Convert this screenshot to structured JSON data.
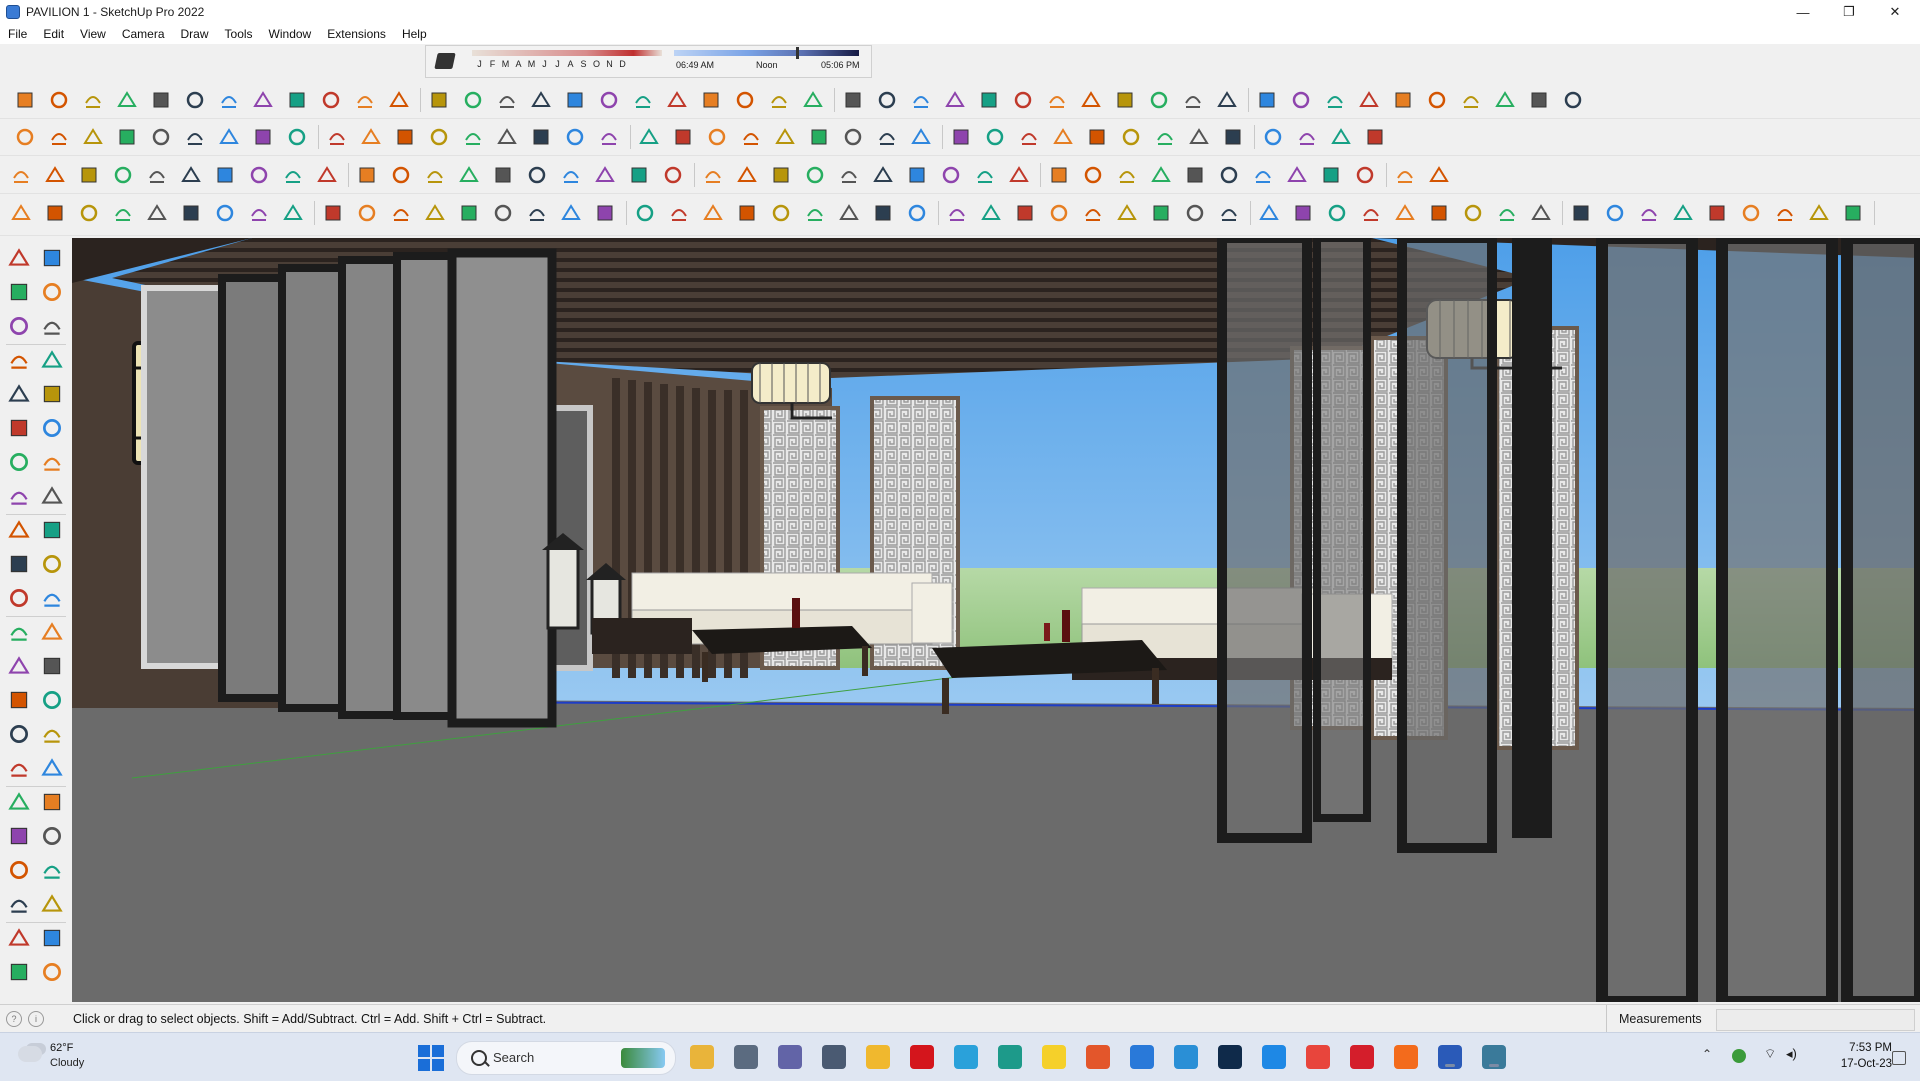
{
  "window": {
    "title": "PAVILION 1 - SketchUp Pro 2022",
    "minimize": "—",
    "maximize": "❐",
    "close": "✕"
  },
  "menu": [
    "File",
    "Edit",
    "View",
    "Camera",
    "Draw",
    "Tools",
    "Window",
    "Extensions",
    "Help"
  ],
  "shadow_settings": {
    "months": [
      "J",
      "F",
      "M",
      "A",
      "M",
      "J",
      "J",
      "A",
      "S",
      "O",
      "N",
      "D"
    ],
    "time_start": "06:49 AM",
    "time_noon": "Noon",
    "time_end": "05:06 PM"
  },
  "status": {
    "hint": "Click or drag to select objects. Shift = Add/Subtract. Ctrl = Add. Shift + Ctrl = Subtract.",
    "measurements_label": "Measurements",
    "measurements_value": ""
  },
  "taskbar": {
    "weather_temp": "62°F",
    "weather_condition": "Cloudy",
    "search_label": "Search",
    "clock_time": "7:53 PM",
    "clock_date": "17-Oct-23"
  },
  "colors": {
    "accent": "#1a6ed8",
    "toolbar_bg": "#f0f0f0",
    "sky_top": "#5aa8ee",
    "grass": "#9dc98a",
    "floor": "#6a6a6a",
    "frame": "#222222",
    "sofa": "#f2efe4"
  }
}
